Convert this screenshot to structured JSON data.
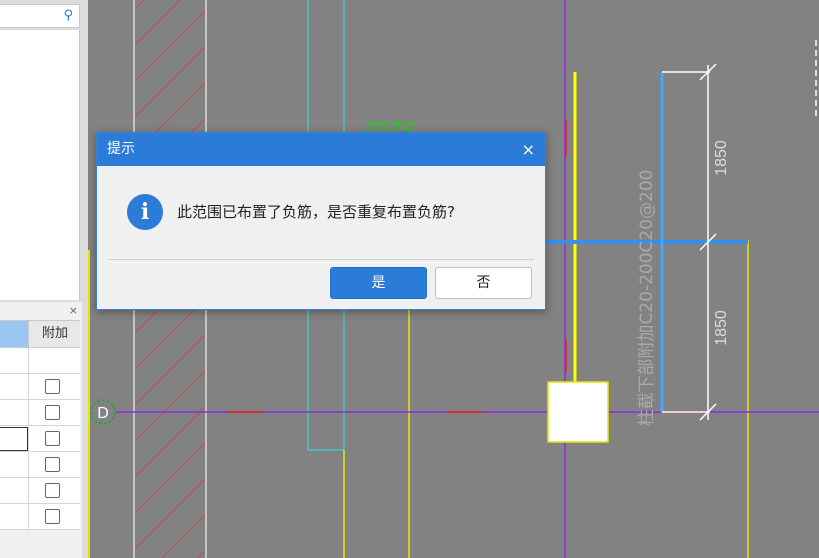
{
  "left_panel": {
    "search_icon": "search-icon",
    "column_header": "附加",
    "close_glyph": "×",
    "rows": [
      {
        "checked": false
      },
      {
        "checked": false
      },
      {
        "checked": false
      },
      {
        "checked": false
      },
      {
        "checked": false
      },
      {
        "checked": false
      }
    ]
  },
  "drawing": {
    "axis_label": "D",
    "section_label": "SZ02",
    "dimension_1": "1850",
    "dimension_2": "1850",
    "rebar_label": "柱截下部附加C20-200C20@200"
  },
  "dialog": {
    "title": "提示",
    "close_glyph": "×",
    "icon": "info-icon",
    "icon_glyph": "i",
    "message": "此范围已布置了负筋，是否重复布置负筋?",
    "yes_label": "是",
    "no_label": "否"
  },
  "colors": {
    "canvas_bg": "#828282",
    "accent": "#2b7bd9",
    "axis_line": "#8a2be2",
    "beam_line": "#ffff00",
    "column_fill": "#ffffff",
    "rebar_line": "#4aa3ff",
    "dimension": "#ffffff",
    "hatch": "#c05050"
  }
}
